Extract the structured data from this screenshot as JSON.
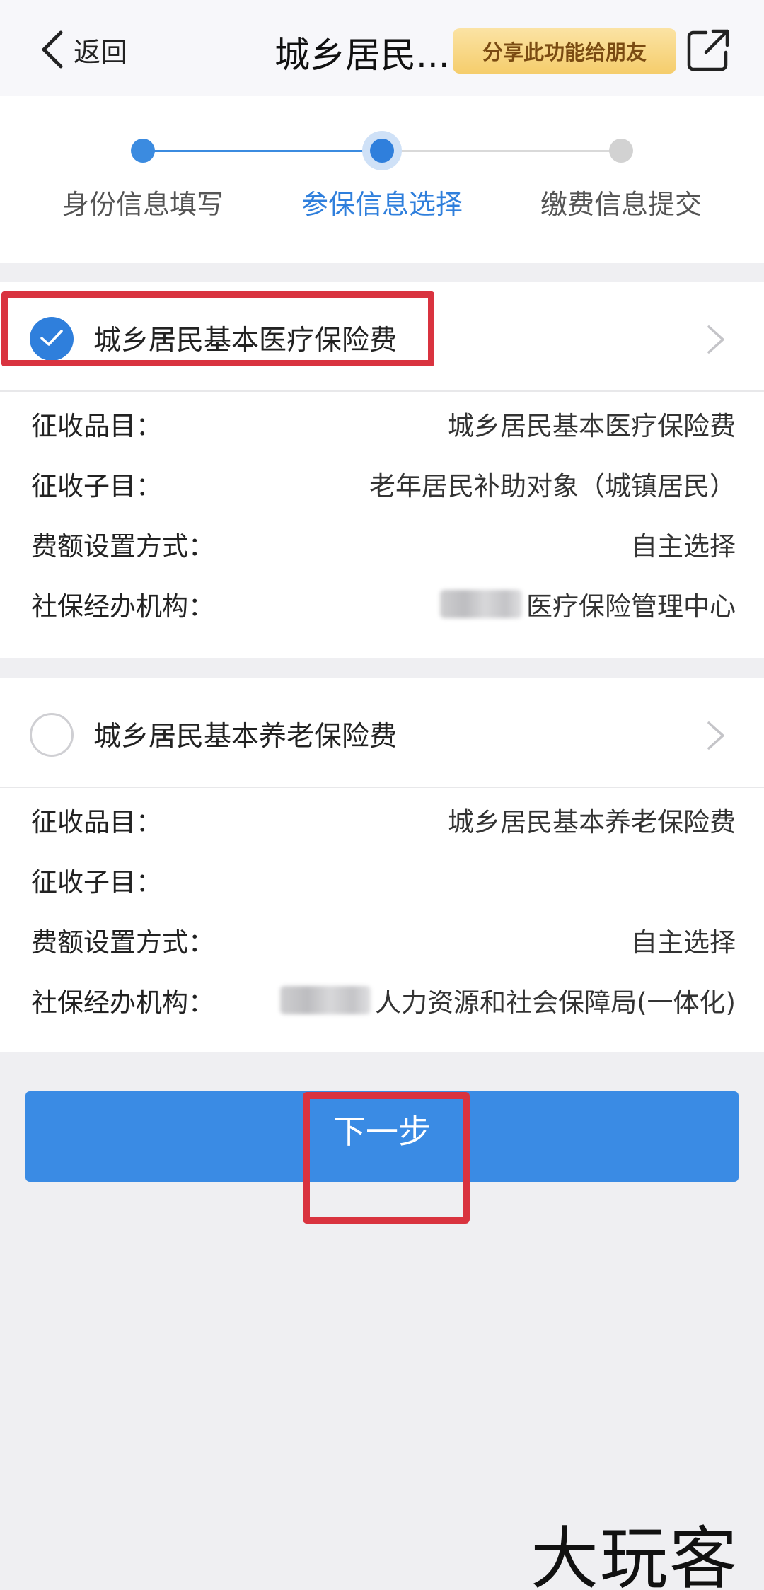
{
  "header": {
    "back_label": "返回",
    "title": "城乡居民...",
    "share_label": "分享此功能给朋友",
    "icons": {
      "back": "chevron-left-icon",
      "share": "external-share-icon"
    }
  },
  "stepper": {
    "steps": [
      {
        "label": "身份信息填写",
        "state": "done"
      },
      {
        "label": "参保信息选择",
        "state": "current"
      },
      {
        "label": "缴费信息提交",
        "state": "todo"
      }
    ]
  },
  "insurance_items": [
    {
      "title": "城乡居民基本医疗保险费",
      "selected": true,
      "rows": [
        {
          "label": "征收品目：",
          "value": "城乡居民基本医疗保险费"
        },
        {
          "label": "征收子目：",
          "value": "老年居民补助对象（城镇居民）"
        },
        {
          "label": "费额设置方式：",
          "value": "自主选择"
        },
        {
          "label": "社保经办机构：",
          "value": "医疗保险管理中心"
        }
      ]
    },
    {
      "title": "城乡居民基本养老保险费",
      "selected": false,
      "rows": [
        {
          "label": "征收品目：",
          "value": "城乡居民基本养老保险费"
        },
        {
          "label": "征收子目：",
          "value": ""
        },
        {
          "label": "费额设置方式：",
          "value": "自主选择"
        },
        {
          "label": "社保经办机构：",
          "value": "人力资源和社会保障局(一体化)"
        }
      ]
    }
  ],
  "next_button_label": "下一步",
  "watermark": "大玩客",
  "colors": {
    "accent": "#2f7fdc",
    "button": "#3a8be4",
    "annotation_red": "#d9333f",
    "share_badge": "#f5cd6c"
  }
}
